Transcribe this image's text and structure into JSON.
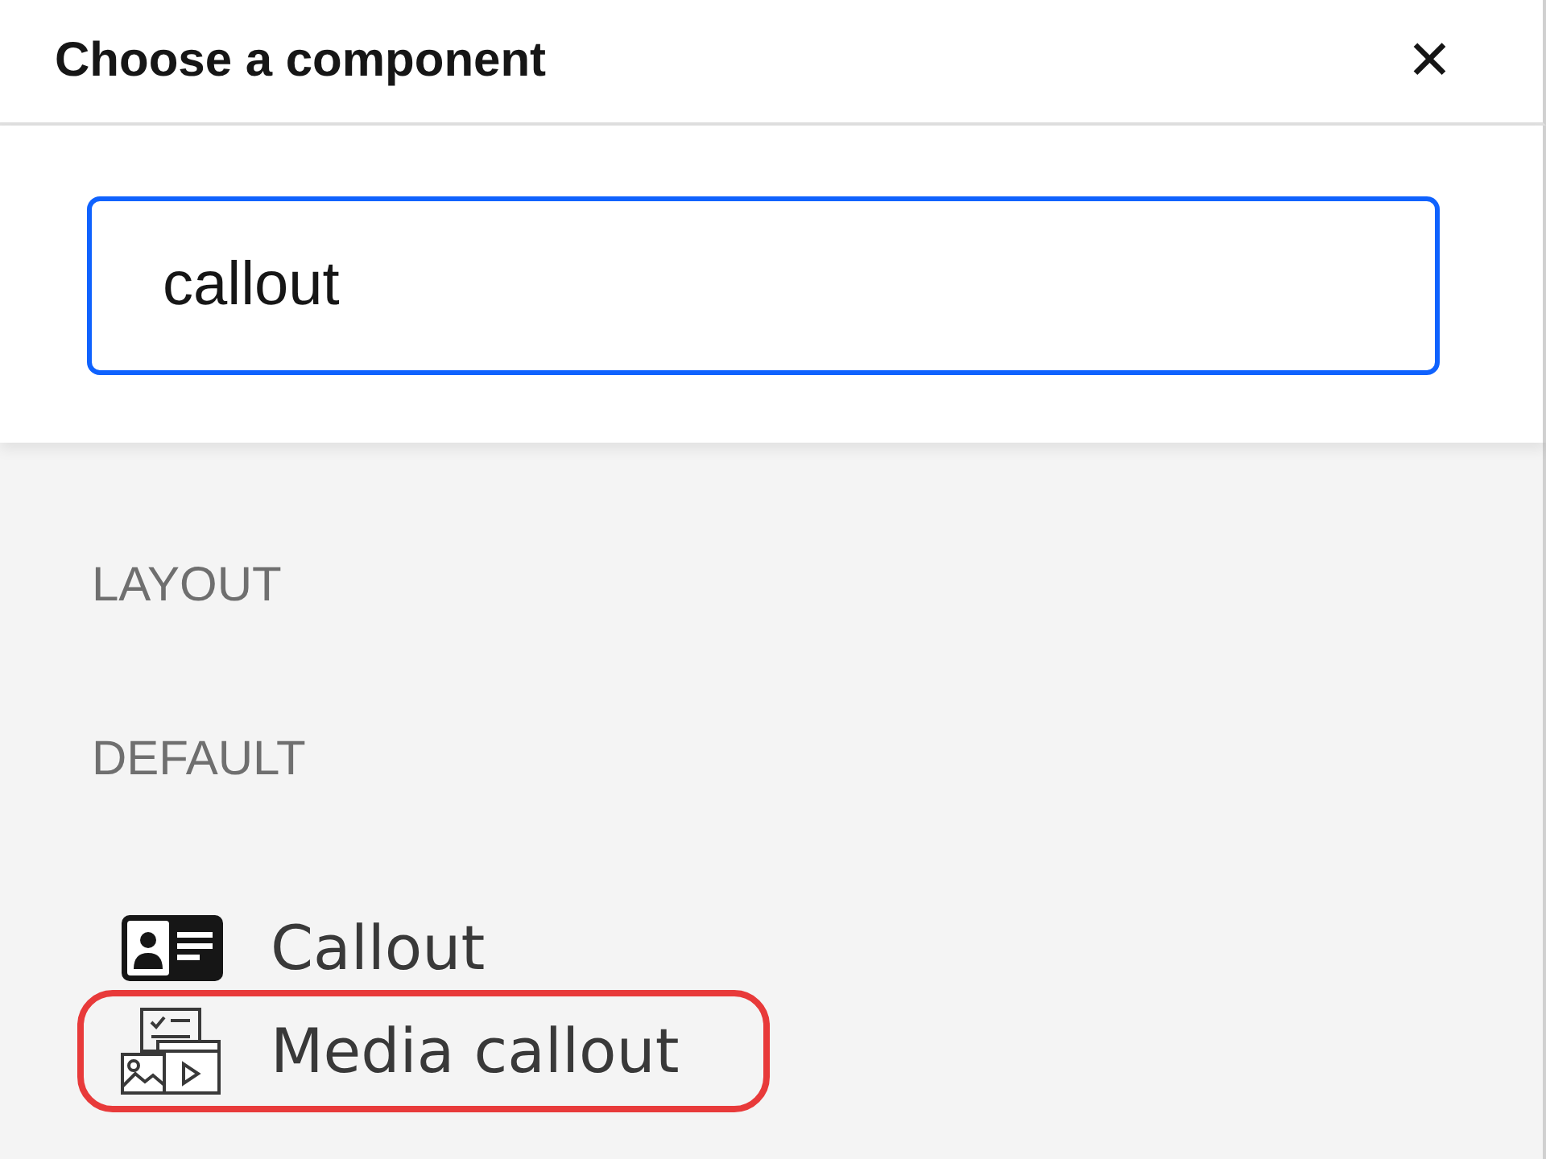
{
  "dialog": {
    "title": "Choose a component",
    "close_icon": "✕"
  },
  "search": {
    "value": "callout"
  },
  "sections": [
    {
      "heading": "LAYOUT"
    },
    {
      "heading": "DEFAULT",
      "items": [
        {
          "label": "Callout",
          "kind": "callout",
          "highlighted": false
        },
        {
          "label": "Media callout",
          "kind": "media",
          "highlighted": true
        }
      ]
    }
  ]
}
